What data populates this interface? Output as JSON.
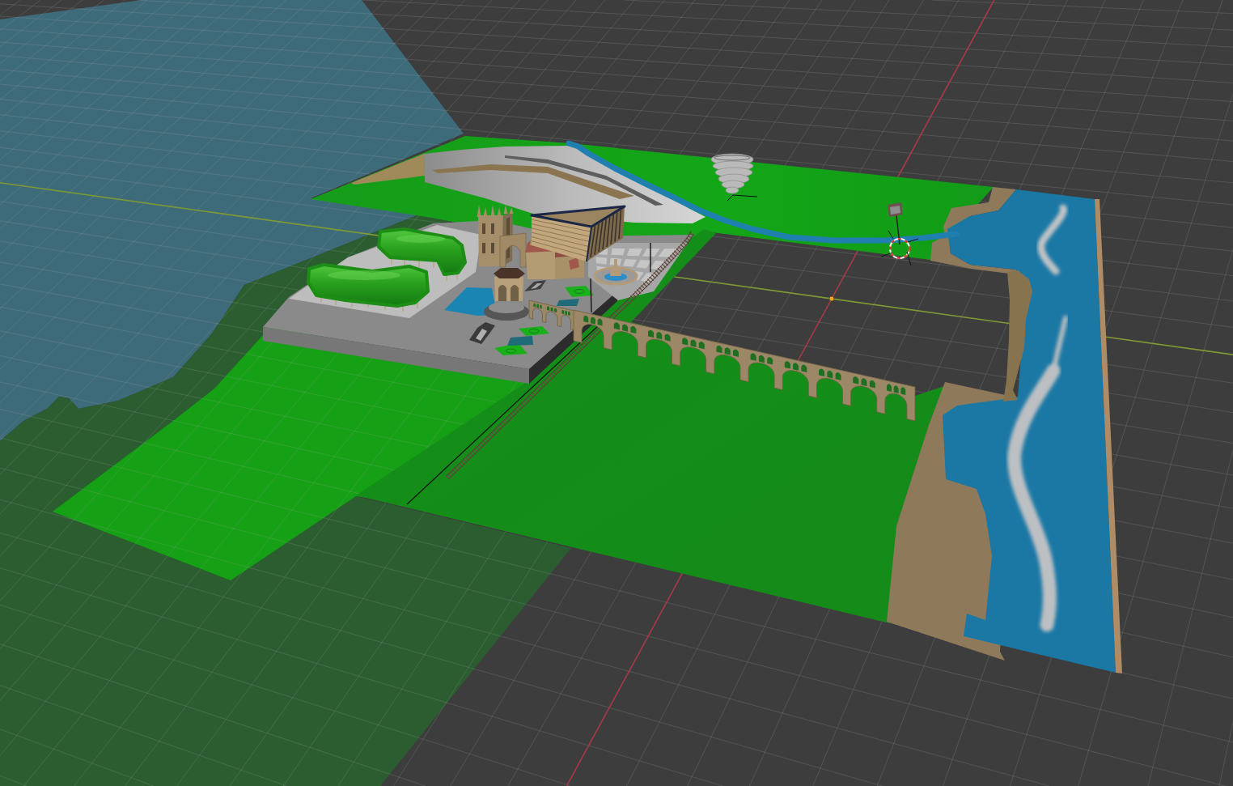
{
  "viewport": {
    "overlays": {
      "floor_grid": true,
      "axis_x": true,
      "axis_y": true,
      "cursor_3d": true
    }
  }
}
